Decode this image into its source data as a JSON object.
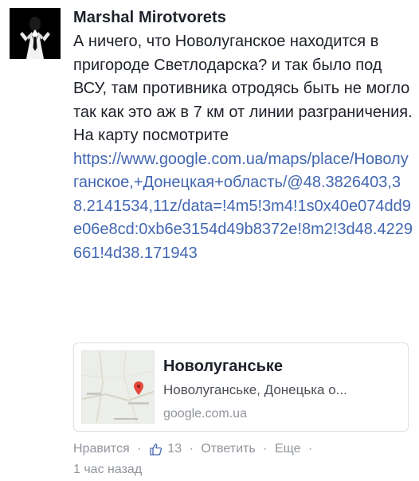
{
  "comment": {
    "author": "Marshal Mirotvorets",
    "text": "А ничего, что Новолуганское находится в пригороде Светлодарска? и так было под ВСУ, там противника отродясь быть не могло так как это аж в 7 км от линии разграничения. На карту посмотрите",
    "link": "https://www.google.com.ua/maps/place/Новолуганское,+Донецкая+область/@48.3826403,38.2141534,11z/data=!4m5!3m4!1s0x40e074dd9e06e8cd:0xb6e3154d49b8372e!8m2!3d48.4229661!4d38.171943"
  },
  "preview": {
    "title": "Новолуганське",
    "subtitle": "Новолуганське, Донецька о...",
    "domain": "google.com.ua",
    "map_icon": "map-pin-icon"
  },
  "actions": {
    "like": "Нравится",
    "like_icon": "thumbs-up-icon",
    "like_count": "13",
    "reply": "Ответить",
    "more": "Еще",
    "separator": "·",
    "timestamp": "1 час назад"
  },
  "colors": {
    "link": "#4267b2",
    "text": "#1d2129",
    "meta": "#90949c",
    "pin": "#e5483c"
  }
}
